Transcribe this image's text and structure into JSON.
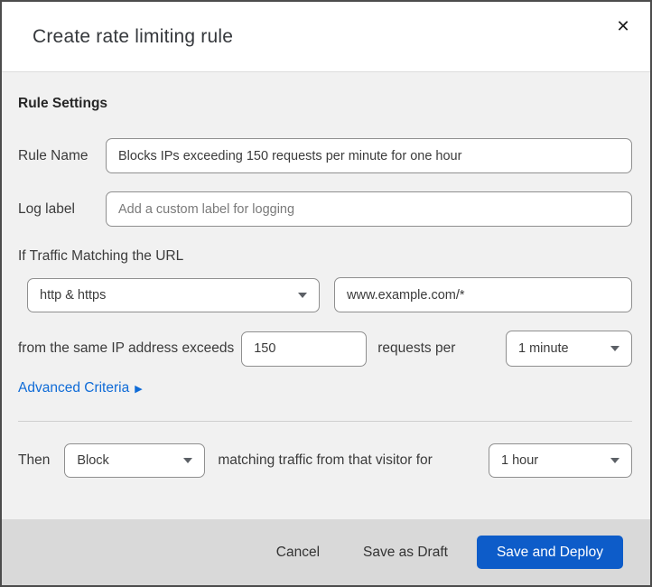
{
  "dialog": {
    "title": "Create rate limiting rule"
  },
  "icons": {
    "close": "✕",
    "advanced_arrow": "▶"
  },
  "form": {
    "section_heading": "Rule Settings",
    "rule_name": {
      "label": "Rule Name",
      "value": "Blocks IPs exceeding 150 requests per minute for one hour"
    },
    "log_label": {
      "label": "Log label",
      "placeholder": "Add a custom label for logging"
    },
    "traffic_match": {
      "intro": "If Traffic Matching the URL",
      "scheme_selected": "http & https",
      "url_value": "www.example.com/*",
      "exceeds_text": "from the same IP address exceeds",
      "requests_value": "150",
      "requests_per_text": "requests per",
      "period_selected": "1 minute",
      "advanced_link": "Advanced Criteria"
    },
    "action": {
      "then_label": "Then",
      "action_selected": "Block",
      "middle_text": "matching traffic from that visitor for",
      "duration_selected": "1 hour"
    }
  },
  "footer": {
    "cancel": "Cancel",
    "save_draft": "Save as Draft",
    "save_deploy": "Save and Deploy"
  },
  "colors": {
    "primary_button": "#0d5cc9",
    "link_blue": "#0f6bd7",
    "body_background": "#f1f1f1",
    "footer_background": "#d9d9d9"
  }
}
